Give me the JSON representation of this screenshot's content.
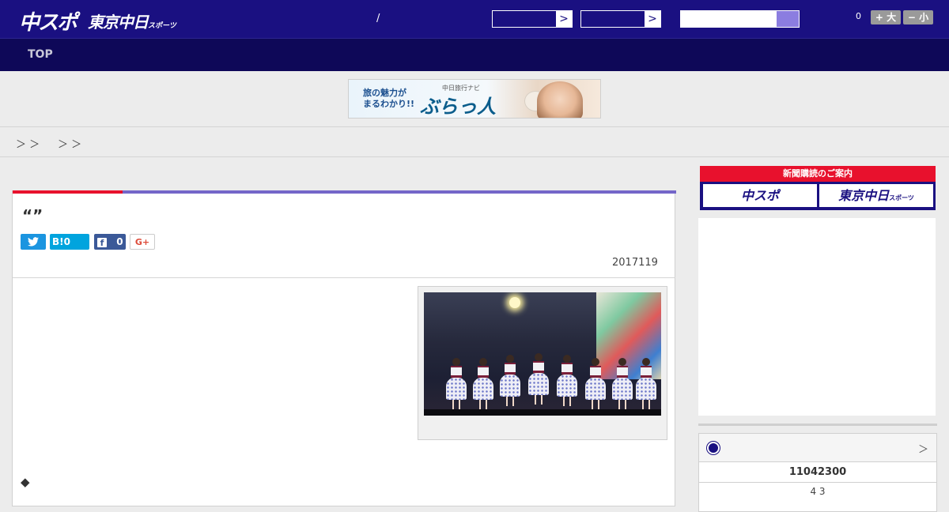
{
  "header": {
    "logo_chuspo": "中スポ",
    "logo_tokyo": "東京中日",
    "logo_tokyo_sub": "スポーツ",
    "slash": "/",
    "select_arrow": ">",
    "font_count": "0",
    "font_larger": "+ 大",
    "font_smaller": "− 小",
    "colors": {
      "brand": "#1a1081",
      "nav": "#0e0858",
      "accent_red": "#e8112d",
      "accent_purple": "#7466c9"
    }
  },
  "nav": {
    "top_label": "TOP"
  },
  "banner": {
    "text_line1": "旅の魅力が",
    "text_line2": "まるわかり!!",
    "brand_small": "中日旅行ナビ",
    "brand_big": "ぶらっ人"
  },
  "breadcrumb": {
    "sep1": "＞ ＞",
    "sep2": "＞ ＞"
  },
  "article": {
    "headline": "“”",
    "share": {
      "twitter_count": "",
      "hatena_label": "B!",
      "hatena_count": "0",
      "facebook_count": "0",
      "gplus_label": "G+"
    },
    "date": "2017119",
    "bullet": "◆"
  },
  "sidebar": {
    "subscription_title": "新聞購読のご案内",
    "sub_chuspo": "中スポ",
    "sub_tokyo": "東京中日",
    "sub_tokyo_small": "スポーツ",
    "score_more": "＞",
    "score_line1": "11042300",
    "score_line2": "4  3"
  }
}
